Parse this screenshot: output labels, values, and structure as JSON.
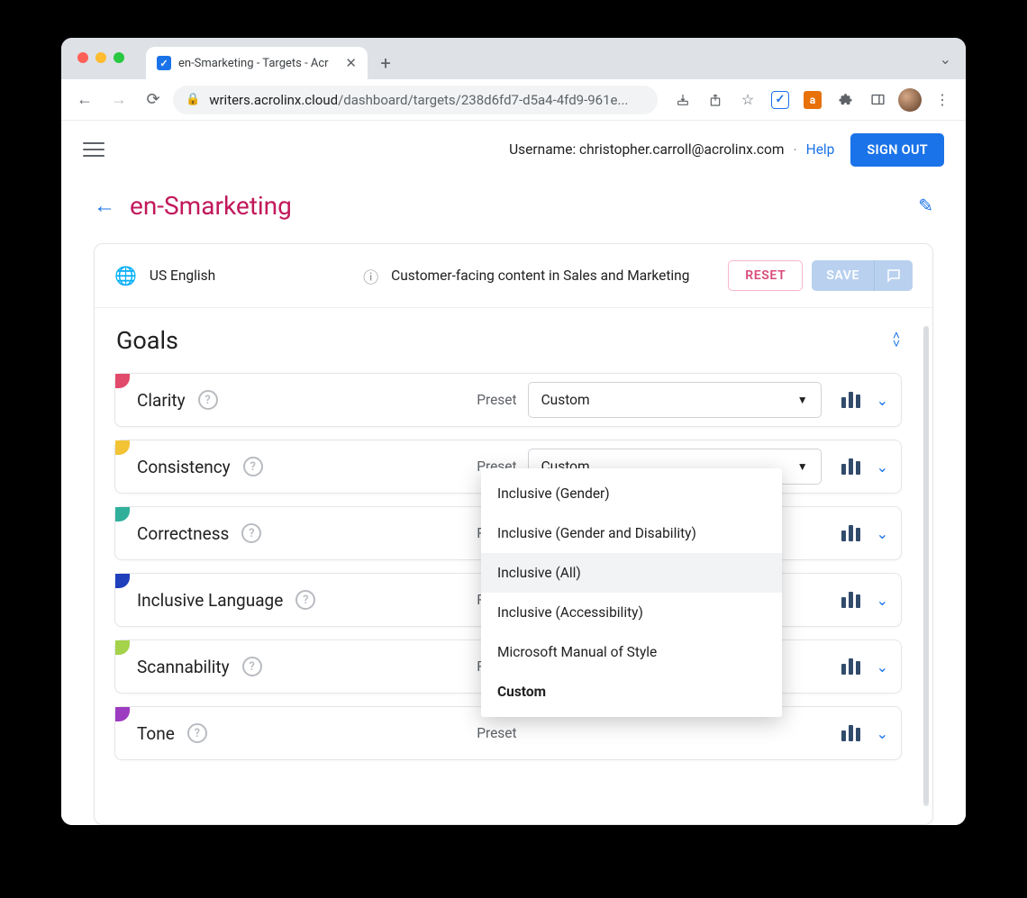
{
  "browser": {
    "tab_title": "en-Smarketing - Targets - Acr",
    "url_host": "writers.acrolinx.cloud",
    "url_path": "/dashboard/targets/238d6fd7-d5a4-4fd9-961e..."
  },
  "topbar": {
    "username_label": "Username: christopher.carroll@acrolinx.com",
    "help": "Help",
    "signout": "SIGN OUT"
  },
  "page": {
    "title": "en-Smarketing",
    "language": "US English",
    "description": "Customer-facing content in Sales and Marketing",
    "reset": "RESET",
    "save": "SAVE",
    "goals_header": "Goals",
    "preset_label": "Preset"
  },
  "goals": [
    {
      "name": "Clarity",
      "color": "#e24a6b",
      "preset": "Custom",
      "showSelect": true
    },
    {
      "name": "Consistency",
      "color": "#f2c335",
      "preset": "Custom",
      "showSelect": true
    },
    {
      "name": "Correctness",
      "color": "#30b09a",
      "preset": "",
      "showSelect": false
    },
    {
      "name": "Inclusive Language",
      "color": "#1f3fbd",
      "preset": "",
      "showSelect": false
    },
    {
      "name": "Scannability",
      "color": "#a4d24a",
      "preset": "",
      "showSelect": false
    },
    {
      "name": "Tone",
      "color": "#9c3cc0",
      "preset": "",
      "showSelect": false
    }
  ],
  "dropdown": {
    "options": [
      "Inclusive (Gender)",
      "Inclusive (Gender and Disability)",
      "Inclusive (All)",
      "Inclusive (Accessibility)",
      "Microsoft Manual of Style",
      "Custom"
    ],
    "hovered": "Inclusive (All)",
    "selected": "Custom"
  }
}
